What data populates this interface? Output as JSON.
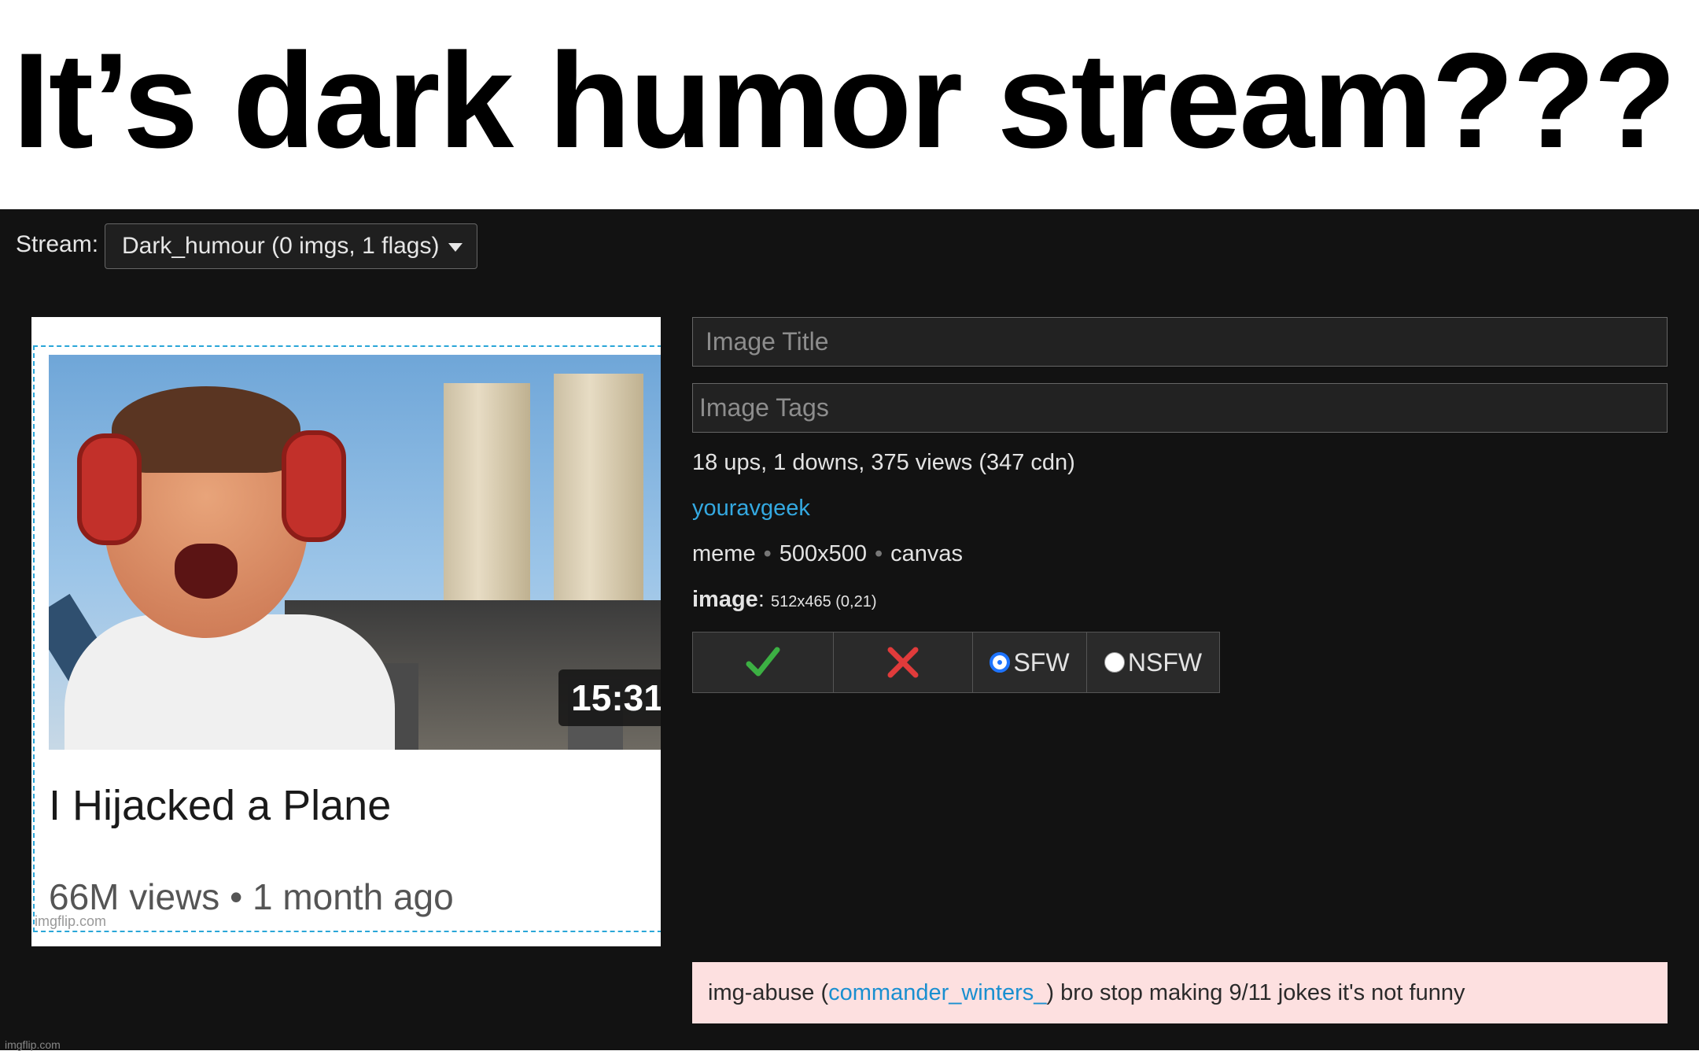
{
  "caption": {
    "text": "It’s dark humor stream???"
  },
  "stream": {
    "label": "Stream:",
    "selected": "Dark_humour (0 imgs, 1 flags)"
  },
  "thumbnail": {
    "duration": "15:31",
    "video_title": "I Hijacked a Plane",
    "video_meta": "66M views • 1 month ago",
    "watermark": "imgflip.com"
  },
  "form": {
    "title_placeholder": "Image Title",
    "tags_placeholder": "Image Tags"
  },
  "stats": {
    "text": "18 ups, 1 downs, 375 views (347 cdn)"
  },
  "author": {
    "name": "youravgeek"
  },
  "info": {
    "type": "meme",
    "size": "500x500",
    "kind": "canvas"
  },
  "image": {
    "label": "image",
    "details": "512x465 (0,21)"
  },
  "buttons": {
    "approve_glyph": "✓",
    "reject_glyph": "✕",
    "sfw": "SFW",
    "nsfw": "NSFW",
    "approve_color": "#3cb043",
    "reject_color": "#e03b3b"
  },
  "flag": {
    "prefix": "img-abuse (",
    "user": "commander_winters_",
    "message": ") bro stop making 9/11 jokes it's not funny"
  },
  "footer": {
    "watermark": "imgflip.com"
  },
  "icons": {
    "dropdown": "chevron-down-icon",
    "approve": "check-icon",
    "reject": "cross-icon"
  }
}
